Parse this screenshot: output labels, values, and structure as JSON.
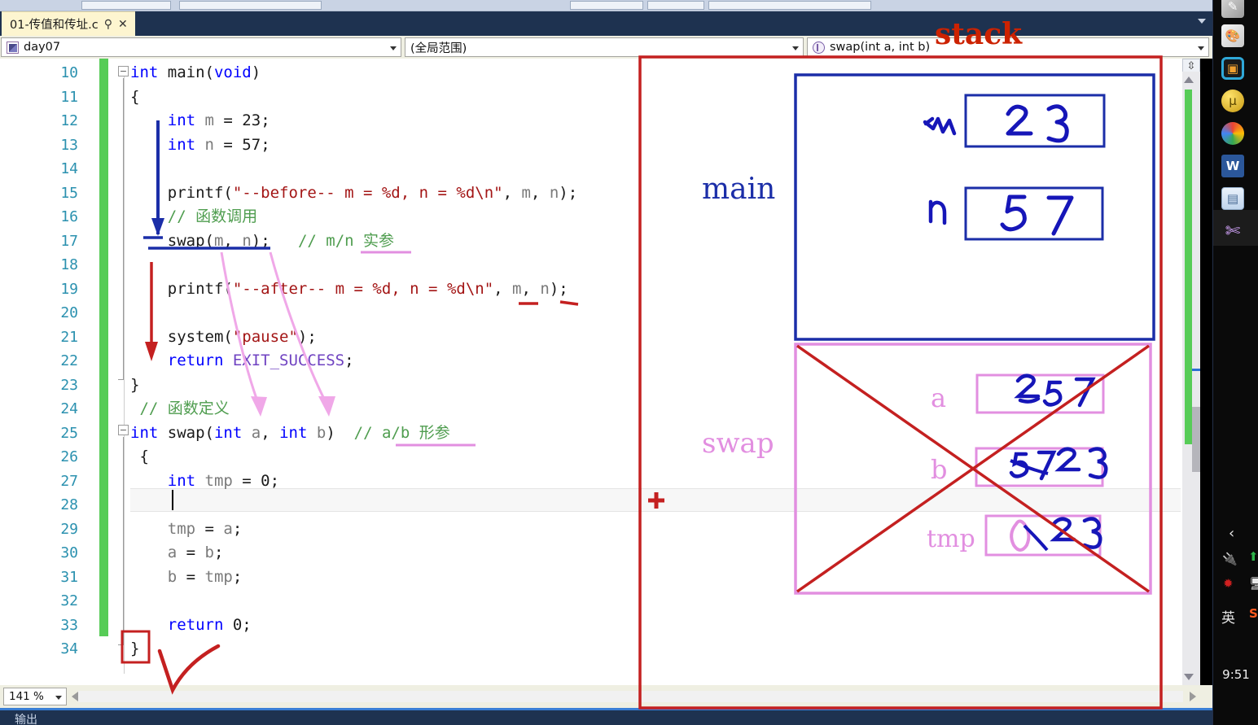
{
  "window": {
    "tab": {
      "title": "01-传值和传址.c",
      "pin_icon": "pin-icon",
      "close_icon": "close-icon"
    },
    "tabstrip_dropdown_icon": "chevron-down-icon"
  },
  "navbar": {
    "project": {
      "label": "day07",
      "icon": "project-icon"
    },
    "scope": {
      "label": "(全局范围)"
    },
    "member": {
      "label": "swap(int a, int b)",
      "icon": "method-icon"
    }
  },
  "editor": {
    "zoom_level": "141 %",
    "first_line": 10,
    "lines": [
      {
        "n": "10",
        "tokens": [
          {
            "t": "int ",
            "c": "kw"
          },
          {
            "t": "main",
            "c": "fn"
          },
          {
            "t": "(",
            "c": "plain"
          },
          {
            "t": "void",
            "c": "kw"
          },
          {
            "t": ")",
            "c": "plain"
          }
        ]
      },
      {
        "n": "11",
        "tokens": [
          {
            "t": "{",
            "c": "plain"
          }
        ]
      },
      {
        "n": "12",
        "tokens": [
          {
            "t": "    int ",
            "c": "kw"
          },
          {
            "t": "m",
            "c": "id"
          },
          {
            "t": " = ",
            "c": "plain"
          },
          {
            "t": "23",
            "c": "plain"
          },
          {
            "t": ";",
            "c": "plain"
          }
        ]
      },
      {
        "n": "13",
        "tokens": [
          {
            "t": "    int ",
            "c": "kw"
          },
          {
            "t": "n",
            "c": "id"
          },
          {
            "t": " = ",
            "c": "plain"
          },
          {
            "t": "57",
            "c": "plain"
          },
          {
            "t": ";",
            "c": "plain"
          }
        ]
      },
      {
        "n": "14",
        "tokens": []
      },
      {
        "n": "15",
        "tokens": [
          {
            "t": "    printf",
            "c": "fn"
          },
          {
            "t": "(",
            "c": "plain"
          },
          {
            "t": "\"--before-- m = %d, n = %d\\n\"",
            "c": "str"
          },
          {
            "t": ", ",
            "c": "plain"
          },
          {
            "t": "m",
            "c": "id"
          },
          {
            "t": ", ",
            "c": "plain"
          },
          {
            "t": "n",
            "c": "id"
          },
          {
            "t": ");",
            "c": "plain"
          }
        ]
      },
      {
        "n": "16",
        "tokens": [
          {
            "t": "    // 函数调用",
            "c": "cmt"
          }
        ]
      },
      {
        "n": "17",
        "tokens": [
          {
            "t": "    swap",
            "c": "fn"
          },
          {
            "t": "(",
            "c": "plain"
          },
          {
            "t": "m",
            "c": "id"
          },
          {
            "t": ", ",
            "c": "plain"
          },
          {
            "t": "n",
            "c": "id"
          },
          {
            "t": ");",
            "c": "plain"
          },
          {
            "t": "   // m/n 实参",
            "c": "cmt"
          }
        ]
      },
      {
        "n": "18",
        "tokens": []
      },
      {
        "n": "19",
        "tokens": [
          {
            "t": "    printf",
            "c": "fn"
          },
          {
            "t": "(",
            "c": "plain"
          },
          {
            "t": "\"--after-- m = %d, n = %d\\n\"",
            "c": "str"
          },
          {
            "t": ", ",
            "c": "plain"
          },
          {
            "t": "m",
            "c": "id"
          },
          {
            "t": ", ",
            "c": "plain"
          },
          {
            "t": "n",
            "c": "id"
          },
          {
            "t": ");",
            "c": "plain"
          }
        ]
      },
      {
        "n": "20",
        "tokens": []
      },
      {
        "n": "21",
        "tokens": [
          {
            "t": "    system",
            "c": "fn"
          },
          {
            "t": "(",
            "c": "plain"
          },
          {
            "t": "\"pause\"",
            "c": "str"
          },
          {
            "t": ");",
            "c": "plain"
          }
        ]
      },
      {
        "n": "22",
        "tokens": [
          {
            "t": "    return ",
            "c": "kw"
          },
          {
            "t": "EXIT_SUCCESS",
            "c": "macro"
          },
          {
            "t": ";",
            "c": "plain"
          }
        ]
      },
      {
        "n": "23",
        "tokens": [
          {
            "t": "}",
            "c": "plain"
          }
        ]
      },
      {
        "n": "24",
        "tokens": [
          {
            "t": " // 函数定义",
            "c": "cmt"
          }
        ]
      },
      {
        "n": "25",
        "tokens": [
          {
            "t": "int ",
            "c": "kw"
          },
          {
            "t": "swap",
            "c": "fn"
          },
          {
            "t": "(",
            "c": "plain"
          },
          {
            "t": "int ",
            "c": "kw"
          },
          {
            "t": "a",
            "c": "id"
          },
          {
            "t": ", ",
            "c": "plain"
          },
          {
            "t": "int ",
            "c": "kw"
          },
          {
            "t": "b",
            "c": "id"
          },
          {
            "t": ")",
            "c": "plain"
          },
          {
            "t": "  // a/b 形参",
            "c": "cmt"
          }
        ]
      },
      {
        "n": "26",
        "tokens": [
          {
            "t": " {",
            "c": "plain"
          }
        ]
      },
      {
        "n": "27",
        "tokens": [
          {
            "t": "    int ",
            "c": "kw"
          },
          {
            "t": "tmp",
            "c": "id"
          },
          {
            "t": " = ",
            "c": "plain"
          },
          {
            "t": "0",
            "c": "plain"
          },
          {
            "t": ";",
            "c": "plain"
          }
        ]
      },
      {
        "n": "28",
        "tokens": []
      },
      {
        "n": "29",
        "tokens": [
          {
            "t": "    tmp",
            "c": "id"
          },
          {
            "t": " = ",
            "c": "plain"
          },
          {
            "t": "a",
            "c": "id"
          },
          {
            "t": ";",
            "c": "plain"
          }
        ]
      },
      {
        "n": "30",
        "tokens": [
          {
            "t": "    a",
            "c": "id"
          },
          {
            "t": " = ",
            "c": "plain"
          },
          {
            "t": "b",
            "c": "id"
          },
          {
            "t": ";",
            "c": "plain"
          }
        ]
      },
      {
        "n": "31",
        "tokens": [
          {
            "t": "    b",
            "c": "id"
          },
          {
            "t": " = ",
            "c": "plain"
          },
          {
            "t": "tmp",
            "c": "id"
          },
          {
            "t": ";",
            "c": "plain"
          }
        ]
      },
      {
        "n": "32",
        "tokens": []
      },
      {
        "n": "33",
        "tokens": [
          {
            "t": "    return ",
            "c": "kw"
          },
          {
            "t": "0",
            "c": "plain"
          },
          {
            "t": ";",
            "c": "plain"
          }
        ]
      },
      {
        "n": "34",
        "tokens": [
          {
            "t": "}",
            "c": "plain"
          }
        ]
      }
    ]
  },
  "annotations": {
    "stack_label": "stack",
    "main_frame_label": "main",
    "swap_frame_label": "swap",
    "main_vars": [
      {
        "name": "m",
        "value": "23"
      },
      {
        "name": "n",
        "value": "57"
      }
    ],
    "swap_vars": [
      {
        "name": "a",
        "value": "23 57"
      },
      {
        "name": "b",
        "value": "57 23"
      },
      {
        "name": "tmp",
        "value": "0 23"
      }
    ],
    "colors": {
      "stack_red": "#cc2200",
      "main_blue": "#1b2ea8",
      "swap_pink": "#e28fe0",
      "handwriting_blue": "#1616b8",
      "call_arrow_pink": "#f0a8e8",
      "flow_arrow_blue": "#1b2ea8",
      "flow_arrow_red": "#c42020"
    },
    "pen_cursor": "plus-cursor"
  },
  "bottom": {
    "output_label": "输出"
  },
  "taskbar": {
    "icons": [
      "note-icon",
      "paint-icon",
      "snipaste-icon",
      "utorrent-icon",
      "chrome-icon",
      "word-icon",
      "notepad-icon",
      "vscode-icon"
    ],
    "tray": {
      "expand_icon": "chevron-left-icon",
      "battery_icon": "battery-icon",
      "onedrive_icon": "onedrive-up-icon",
      "antivirus_icon": "antivirus-icon",
      "network_icon": "network-icon",
      "ime_label": "英",
      "sogou_icon": "sogou-icon",
      "clock": "9:51"
    }
  }
}
